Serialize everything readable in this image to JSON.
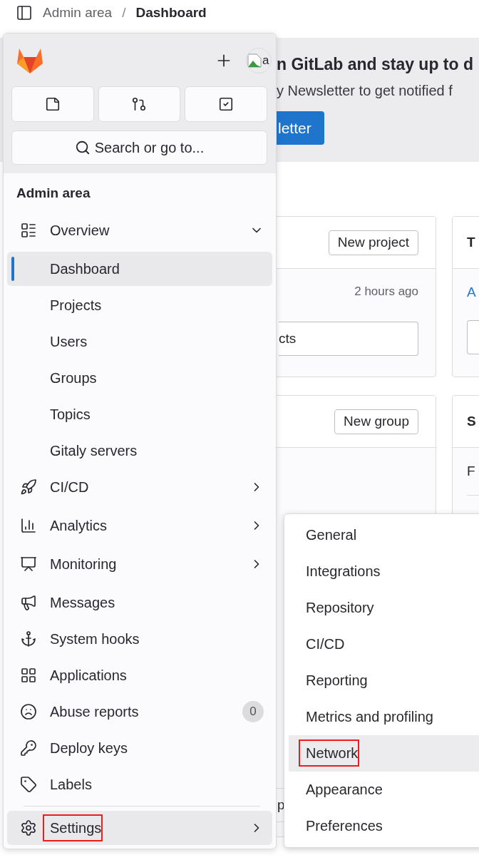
{
  "breadcrumb_separator": "/",
  "breadcrumb": [
    {
      "label": "Admin area",
      "current": false
    },
    {
      "label": "Dashboard",
      "current": true
    }
  ],
  "banner": {
    "title": "n GitLab and stay up to d",
    "text": "y Newsletter to get notified f",
    "button": "letter"
  },
  "cards": [
    {
      "kind": "projects",
      "header_button": "New project",
      "meta": "2 hours ago",
      "field_text": "cts"
    },
    {
      "kind": "groups",
      "header_button": "New group",
      "row_text": "p"
    }
  ],
  "side_cards": [
    {
      "kind": "link",
      "title": "T",
      "body": "A"
    },
    {
      "kind": "text",
      "title": "S",
      "body": "F"
    }
  ],
  "sidebar": {
    "avatar": {
      "alt_text": "a"
    },
    "search": {
      "placeholder": "Search or go to..."
    },
    "section_title": "Admin area",
    "items": [
      {
        "label": "Overview",
        "kind": "group",
        "expanded": true,
        "hovered": false,
        "annotated": false,
        "children": [
          {
            "label": "Dashboard",
            "selected": true
          },
          {
            "label": "Projects",
            "selected": false
          },
          {
            "label": "Users",
            "selected": false
          },
          {
            "label": "Groups",
            "selected": false
          },
          {
            "label": "Topics",
            "selected": false
          },
          {
            "label": "Gitaly servers",
            "selected": false
          }
        ]
      },
      {
        "label": "CI/CD",
        "kind": "group",
        "expanded": false,
        "hovered": false,
        "annotated": false
      },
      {
        "label": "Analytics",
        "kind": "group",
        "expanded": false,
        "hovered": false,
        "annotated": false
      },
      {
        "label": "Monitoring",
        "kind": "group",
        "expanded": false,
        "hovered": false,
        "annotated": false
      },
      {
        "label": "Messages",
        "kind": "link",
        "hovered": false,
        "annotated": false
      },
      {
        "label": "System hooks",
        "kind": "link",
        "hovered": false,
        "annotated": false
      },
      {
        "label": "Applications",
        "kind": "link",
        "hovered": false,
        "annotated": false
      },
      {
        "label": "Abuse reports",
        "kind": "link",
        "hovered": false,
        "annotated": false,
        "badge": "0"
      },
      {
        "label": "Deploy keys",
        "kind": "link",
        "hovered": false,
        "annotated": false
      },
      {
        "label": "Labels",
        "kind": "link",
        "hovered": false,
        "annotated": false
      },
      {
        "label": "Settings",
        "kind": "footer-group",
        "expanded": false,
        "hovered": true,
        "annotated": true
      }
    ]
  },
  "flyout": {
    "items": [
      {
        "label": "General",
        "hovered": false,
        "annotated": false
      },
      {
        "label": "Integrations",
        "hovered": false,
        "annotated": false
      },
      {
        "label": "Repository",
        "hovered": false,
        "annotated": false
      },
      {
        "label": "CI/CD",
        "hovered": false,
        "annotated": false
      },
      {
        "label": "Reporting",
        "hovered": false,
        "annotated": false
      },
      {
        "label": "Metrics and profiling",
        "hovered": false,
        "annotated": false
      },
      {
        "label": "Network",
        "hovered": true,
        "annotated": true
      },
      {
        "label": "Appearance",
        "hovered": false,
        "annotated": false
      },
      {
        "label": "Preferences",
        "hovered": false,
        "annotated": false
      }
    ]
  }
}
